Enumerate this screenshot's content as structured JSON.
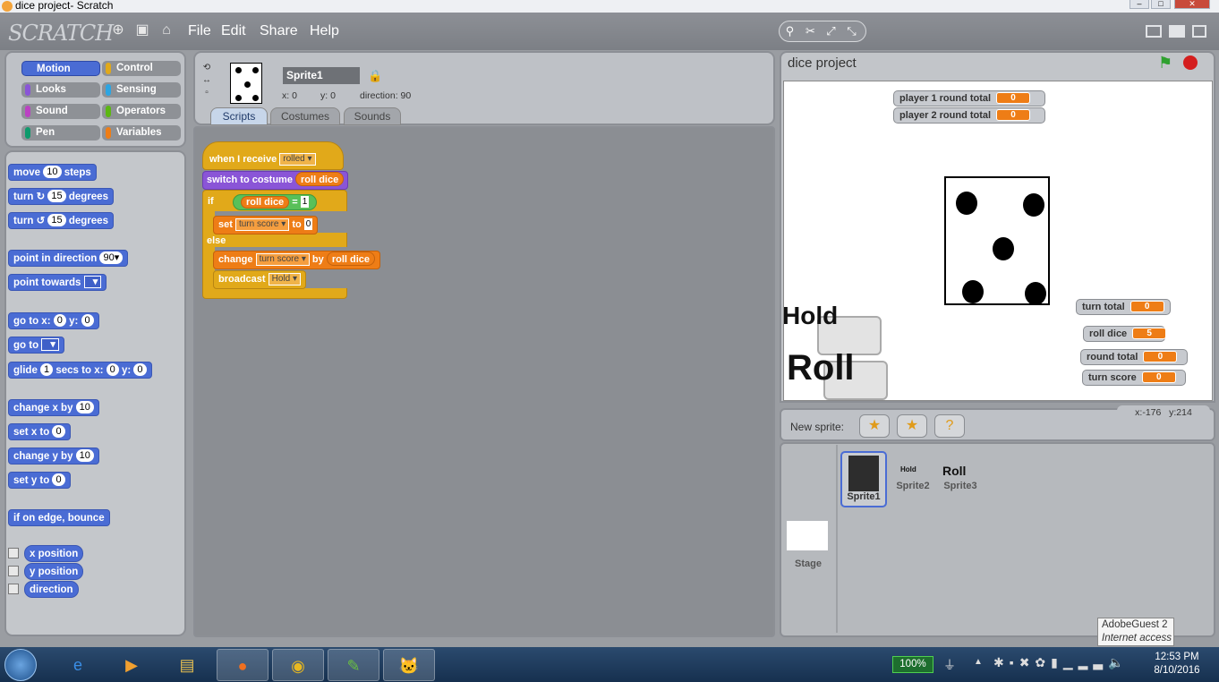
{
  "window": {
    "title": "dice project- Scratch"
  },
  "menubar": {
    "logo": "SCRATCH",
    "menus": [
      "File",
      "Edit",
      "Share",
      "Help"
    ]
  },
  "categories": [
    {
      "label": "Motion",
      "color": "#4a6cd4"
    },
    {
      "label": "Control",
      "color": "#e1a91a"
    },
    {
      "label": "Looks",
      "color": "#8a55d7"
    },
    {
      "label": "Sensing",
      "color": "#2ca5e2"
    },
    {
      "label": "Sound",
      "color": "#bb42c3"
    },
    {
      "label": "Operators",
      "color": "#5cb712"
    },
    {
      "label": "Pen",
      "color": "#0e9a6c"
    },
    {
      "label": "Variables",
      "color": "#ee7d16"
    }
  ],
  "palette": {
    "move": {
      "pre": "move",
      "num": "10",
      "post": "steps"
    },
    "turn_cw": {
      "pre": "turn",
      "icon": "↻",
      "num": "15",
      "post": "degrees"
    },
    "turn_ccw": {
      "pre": "turn",
      "icon": "↺",
      "num": "15",
      "post": "degrees"
    },
    "point_dir": {
      "pre": "point in direction",
      "val": "90▾"
    },
    "point_towards": {
      "pre": "point towards"
    },
    "goto_xy": {
      "pre": "go to x:",
      "x": "0",
      "mid": "y:",
      "y": "0"
    },
    "goto": {
      "pre": "go to"
    },
    "glide": {
      "pre": "glide",
      "secs": "1",
      "mid1": "secs to x:",
      "x": "0",
      "mid2": "y:",
      "y": "0"
    },
    "change_x": {
      "pre": "change x by",
      "num": "10"
    },
    "set_x": {
      "pre": "set x to",
      "num": "0"
    },
    "change_y": {
      "pre": "change y by",
      "num": "10"
    },
    "set_y": {
      "pre": "set y to",
      "num": "0"
    },
    "bounce": "if on edge, bounce",
    "reporters": [
      "x position",
      "y position",
      "direction"
    ]
  },
  "sprite": {
    "name": "Sprite1",
    "x_label": "x:",
    "x": "0",
    "y_label": "y:",
    "y": "0",
    "dir_label": "direction:",
    "direction": "90"
  },
  "tabs": [
    "Scripts",
    "Costumes",
    "Sounds"
  ],
  "script": {
    "hat": {
      "text": "when I receive",
      "msg": "rolled"
    },
    "costume": {
      "text": "switch to costume",
      "val": "roll dice"
    },
    "if": "if",
    "cond": {
      "var": "roll dice",
      "op": "=",
      "val": "1"
    },
    "set": {
      "text": "set",
      "var": "turn score",
      "to": "to",
      "val": "0"
    },
    "else": "else",
    "change": {
      "text": "change",
      "var": "turn score",
      "by": "by",
      "val": "roll dice"
    },
    "broadcast": {
      "text": "broadcast",
      "msg": "Hold"
    }
  },
  "stage": {
    "title": "dice project",
    "monitors": [
      {
        "label": "player 1 round total",
        "value": "0"
      },
      {
        "label": "player 2 round total",
        "value": "0"
      },
      {
        "label": "turn total",
        "value": "0"
      },
      {
        "label": "roll dice",
        "value": "5"
      },
      {
        "label": "round total",
        "value": "0"
      },
      {
        "label": "turn score",
        "value": "0"
      }
    ],
    "hold_text": "Hold",
    "roll_text": "Roll",
    "coords": {
      "x_label": "x:",
      "x": "-176",
      "y_label": "y:",
      "y": "214"
    }
  },
  "sprites_panel": {
    "new_sprite_label": "New sprite:",
    "sprites": [
      "Sprite1",
      "Sprite2",
      "Sprite3"
    ],
    "thumb_texts": {
      "sprite2": "Hold",
      "sprite3": "Roll"
    },
    "stage_label": "Stage"
  },
  "taskbar": {
    "battery": "100%",
    "time": "12:53 PM",
    "date": "8/10/2016"
  },
  "tooltip": {
    "line1": "AdobeGuest 2",
    "line2": "Internet access"
  }
}
